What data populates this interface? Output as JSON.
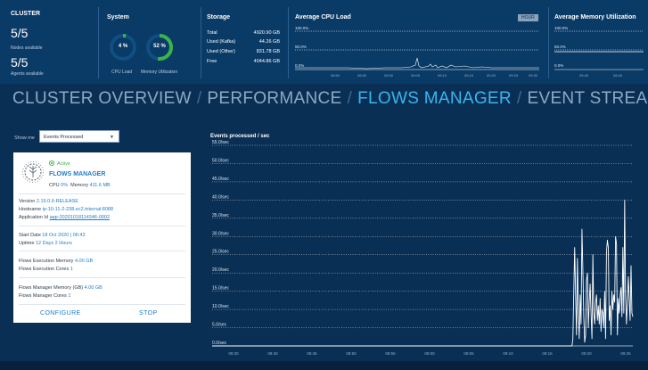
{
  "cluster": {
    "title": "CLUSTER",
    "nodes_value": "5/5",
    "nodes_label": "Nodes available",
    "agents_value": "5/5",
    "agents_label": "Agents available"
  },
  "system": {
    "title": "System",
    "cpu_value": "4 %",
    "cpu_percent": 4,
    "cpu_label": "CPU Load",
    "mem_value": "52 %",
    "mem_percent": 52,
    "mem_label": "Memory Utilization",
    "ring_color": "#3bb34a",
    "ring_bg": "#0f4f82"
  },
  "storage": {
    "title": "Storage",
    "rows": [
      {
        "label": "Total",
        "value": "4920.90 GB"
      },
      {
        "label": "Used (Kafka)",
        "value": "44.26 GB"
      },
      {
        "label": "Used (Other)",
        "value": "831.78 GB"
      },
      {
        "label": "Free",
        "value": "4044.86 GB"
      }
    ]
  },
  "avg_cpu": {
    "title": "Average CPU Load",
    "hour_button": "HOUR",
    "levels": [
      "100.0%",
      "50.0%",
      "0.0%"
    ],
    "ticks": [
      "08:50",
      "08:55",
      "09:00",
      "09:05",
      "09:10",
      "09:15",
      "09:20",
      "09:25",
      "09:30"
    ]
  },
  "avg_mem": {
    "title": "Average Memory Utilization",
    "levels": [
      "100.0%",
      "50.0%",
      "0.0%"
    ],
    "ticks": [
      "09:40",
      "08:45"
    ]
  },
  "nav": {
    "items": [
      "CLUSTER OVERVIEW",
      "PERFORMANCE",
      "FLOWS MANAGER",
      "EVENT STREAMS"
    ],
    "separator": "/",
    "active_index": 2,
    "active_color": "#37b6f0"
  },
  "filter": {
    "label": "Show me",
    "selected": "Events Processed"
  },
  "card": {
    "status": "Active",
    "name": "FLOWS MANAGER",
    "cpu_label": "CPU",
    "cpu_value": "0%",
    "memory_label": "Memory",
    "memory_value": "411.6 MB",
    "version_label": "Version",
    "version_value": "2.19.0.6-RELEASE",
    "hostname_label": "Hostname",
    "hostname_value": "ip-10-11-2-238.ec2.internal:8088",
    "appid_label": "Application Id",
    "appid_value": "app-20201018114346-0002",
    "start_label": "Start Date",
    "start_value": "18 Oct 2020 | 06:43",
    "uptime_label": "Uptime",
    "uptime_value": "12 Days 2 Hours",
    "exec_mem_label": "Flows Execution Memory",
    "exec_mem_value": "4.00 GB",
    "exec_cores_label": "Flows Execution Cores",
    "exec_cores_value": "1",
    "mgr_mem_label": "Flows Manager Memory (GB)",
    "mgr_mem_value": "4.00 GB",
    "mgr_cores_label": "Flows Manager Cores",
    "mgr_cores_value": "1",
    "configure": "CONFIGURE",
    "stop": "STOP"
  },
  "chart_data": {
    "type": "line",
    "title": "Events processed / sec",
    "y_tick_labels": [
      "55.0/sec",
      "50.0/sec",
      "45.0/sec",
      "40.0/sec",
      "35.0/sec",
      "30.0/sec",
      "25.0/sec",
      "20.0/sec",
      "15.0/sec",
      "10.0/sec",
      "5.0/sec",
      "0.0/sec"
    ],
    "x_tick_labels": [
      "08:30",
      "08:40",
      "08:45",
      "08:50",
      "08:55",
      "09:00",
      "09:05",
      "09:10",
      "09:15",
      "09:20",
      "09:25"
    ],
    "ylim": [
      0,
      55
    ],
    "grid": true,
    "line_color": "#ffffff",
    "series": [
      {
        "values": [
          0,
          0,
          0,
          0,
          0,
          0,
          0,
          0,
          0,
          0,
          0,
          0,
          0,
          0,
          0,
          0,
          0,
          0,
          0,
          0,
          0,
          0,
          0,
          0,
          0,
          0,
          0,
          0,
          0,
          0,
          0,
          0,
          0,
          0,
          0,
          0,
          0,
          0,
          0,
          0,
          0,
          0,
          0,
          0,
          0,
          0,
          0,
          0,
          0,
          0,
          0,
          0,
          0,
          0,
          0,
          0,
          0,
          0,
          0,
          0,
          0,
          0,
          0,
          0,
          0,
          0,
          0,
          0,
          0,
          0,
          0,
          0,
          0,
          0,
          0,
          0,
          0,
          0,
          0,
          0,
          0,
          0,
          0,
          0,
          0,
          0,
          0,
          0,
          0,
          0,
          0,
          0,
          0,
          0,
          0,
          0,
          0,
          0,
          0,
          0,
          0,
          0,
          0,
          0,
          0,
          0,
          0,
          0,
          0,
          0,
          0,
          0,
          0,
          0,
          0,
          0,
          0,
          0,
          0,
          0,
          0,
          0,
          0,
          0,
          0,
          0,
          0,
          0,
          0,
          0,
          0,
          0,
          0,
          0,
          0,
          0,
          0,
          0,
          0,
          0,
          0,
          0,
          0,
          0,
          0,
          0,
          0,
          0,
          0,
          0,
          0,
          0,
          0,
          0,
          0,
          0,
          0,
          0,
          0,
          0,
          0,
          0,
          0,
          0,
          0,
          0,
          0,
          0,
          0,
          0,
          0,
          0,
          0,
          0,
          0,
          0,
          0,
          0,
          0,
          0,
          0,
          0,
          0,
          0,
          0,
          0,
          0,
          0,
          0,
          0,
          0,
          0,
          0,
          0,
          0,
          0,
          0,
          0,
          0,
          0,
          0,
          0,
          0,
          0,
          0,
          0,
          0,
          0,
          0,
          0,
          0,
          0,
          0,
          0,
          0,
          0,
          0,
          0,
          0,
          0,
          0,
          0,
          0,
          0,
          0,
          0,
          0,
          0,
          0,
          0,
          0,
          0,
          0,
          0,
          0,
          0,
          0,
          0,
          0,
          0,
          0,
          0,
          0,
          0,
          0,
          0,
          0,
          0,
          0,
          0,
          0,
          0,
          0,
          0,
          0,
          0,
          0,
          0,
          0,
          0,
          0,
          0,
          0,
          0,
          0,
          0,
          0,
          0,
          0,
          0,
          0,
          0,
          0,
          0,
          0,
          0,
          0,
          0,
          0,
          0,
          0,
          0,
          0,
          0,
          0,
          0,
          0,
          0,
          0,
          0,
          0,
          0,
          0,
          0,
          0,
          0,
          0,
          0,
          0,
          0,
          0,
          0,
          0,
          0,
          0,
          0,
          0,
          0,
          0,
          0,
          0,
          0,
          0,
          0,
          0,
          0,
          0,
          0,
          0,
          0,
          0,
          0,
          0,
          0,
          0,
          0,
          0,
          0,
          0,
          0,
          0,
          0,
          0,
          0,
          0,
          0,
          0,
          0,
          0,
          0,
          0,
          0,
          0,
          0,
          0,
          0,
          0,
          0,
          0,
          0,
          0,
          0,
          0,
          0,
          0,
          0,
          0,
          0,
          0,
          0,
          0,
          0,
          0,
          0,
          0,
          0,
          0,
          0,
          0,
          0,
          0,
          0,
          0,
          0,
          0,
          0,
          0,
          0,
          0,
          0,
          0,
          0,
          0,
          0,
          0,
          0,
          0,
          0,
          0,
          0,
          0,
          0,
          0,
          0,
          0,
          0,
          0,
          2,
          15,
          27,
          14,
          3,
          24,
          10,
          2,
          14,
          6,
          32,
          21,
          8,
          1,
          3,
          18,
          20,
          5,
          12,
          17,
          9,
          2,
          25,
          9,
          6,
          12,
          14,
          7,
          11,
          6,
          13,
          4,
          10,
          9,
          5,
          15,
          2,
          26,
          29,
          27,
          7,
          11,
          3,
          15,
          10,
          14,
          12,
          30,
          28,
          3,
          13,
          9,
          14,
          16,
          8,
          27,
          9,
          40,
          14,
          6,
          12,
          19,
          13,
          7,
          22,
          9,
          8
        ]
      }
    ]
  }
}
